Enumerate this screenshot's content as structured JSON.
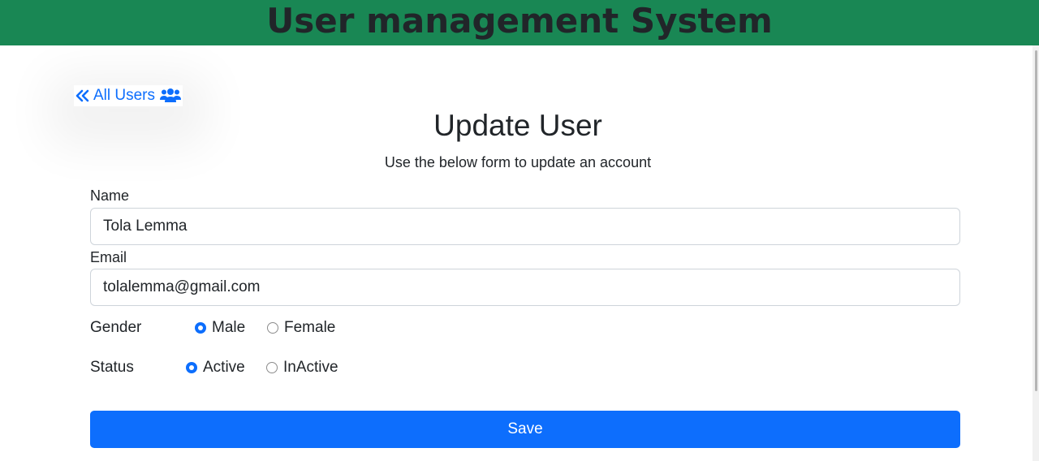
{
  "header": {
    "title": "User management System"
  },
  "nav": {
    "back_label": "All Users",
    "back_icon": "double-chevron-left-icon",
    "users_icon": "users-icon"
  },
  "form": {
    "title": "Update User",
    "subtitle": "Use the below form to update an account",
    "name": {
      "label": "Name",
      "value": "Tola Lemma"
    },
    "email": {
      "label": "Email",
      "value": "tolalemma@gmail.com"
    },
    "gender": {
      "label": "Gender",
      "options": [
        "Male",
        "Female"
      ],
      "selected": "Male"
    },
    "status": {
      "label": "Status",
      "options": [
        "Active",
        "InActive"
      ],
      "selected": "Active"
    },
    "save_label": "Save"
  },
  "colors": {
    "header_bg": "#198754",
    "primary": "#0d6efd"
  }
}
